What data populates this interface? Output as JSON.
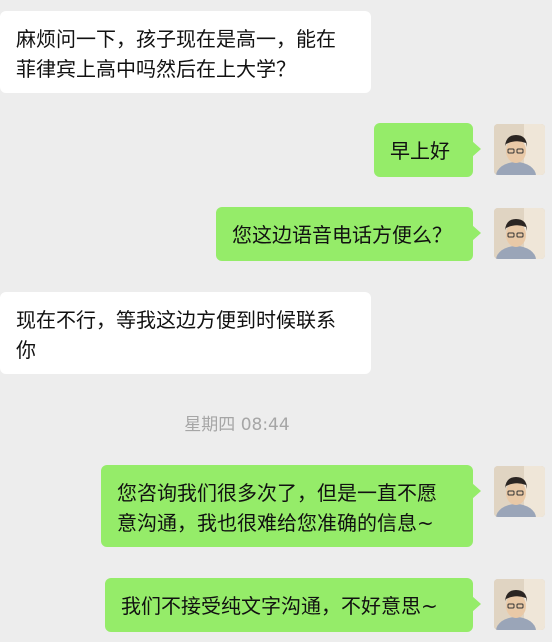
{
  "messages": [
    {
      "side": "in",
      "text": "麻烦问一下，孩子现在是高一，能在\n菲律宾上高中吗然后在上大学？"
    },
    {
      "side": "out",
      "text": "早上好"
    },
    {
      "side": "out",
      "text": "您这边语音电话方便么？"
    },
    {
      "side": "in",
      "text": "现在不行，等我这边方便到时候联系\n你"
    },
    {
      "side": "out",
      "text": "您咨询我们很多次了，但是一直不愿\n意沟通，我也很难给您准确的信息~"
    },
    {
      "side": "out",
      "text": "我们不接受纯文字沟通，不好意思~"
    }
  ],
  "timestamp": "星期四 08:44",
  "colors": {
    "background": "#ededed",
    "incoming_bubble": "#ffffff",
    "outgoing_bubble": "#95ec69",
    "timestamp_text": "#a6a6a6"
  },
  "icons": {
    "sender_avatar": "user-photo-avatar"
  }
}
